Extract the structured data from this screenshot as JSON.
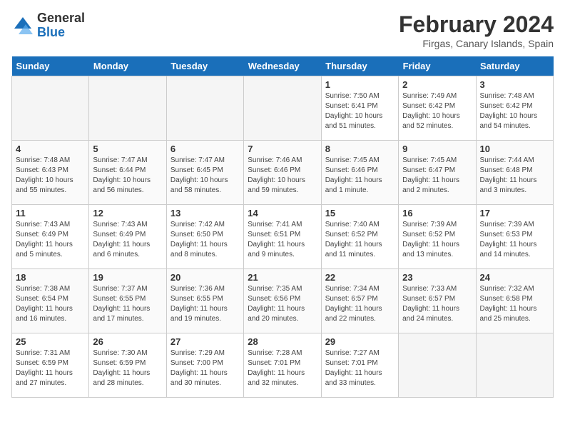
{
  "header": {
    "logo_general": "General",
    "logo_blue": "Blue",
    "month_year": "February 2024",
    "location": "Firgas, Canary Islands, Spain"
  },
  "weekdays": [
    "Sunday",
    "Monday",
    "Tuesday",
    "Wednesday",
    "Thursday",
    "Friday",
    "Saturday"
  ],
  "weeks": [
    [
      {
        "day": "",
        "empty": true
      },
      {
        "day": "",
        "empty": true
      },
      {
        "day": "",
        "empty": true
      },
      {
        "day": "",
        "empty": true
      },
      {
        "day": "1",
        "sunrise": "7:50 AM",
        "sunset": "6:41 PM",
        "daylight": "10 hours and 51 minutes."
      },
      {
        "day": "2",
        "sunrise": "7:49 AM",
        "sunset": "6:42 PM",
        "daylight": "10 hours and 52 minutes."
      },
      {
        "day": "3",
        "sunrise": "7:48 AM",
        "sunset": "6:42 PM",
        "daylight": "10 hours and 54 minutes."
      }
    ],
    [
      {
        "day": "4",
        "sunrise": "7:48 AM",
        "sunset": "6:43 PM",
        "daylight": "10 hours and 55 minutes."
      },
      {
        "day": "5",
        "sunrise": "7:47 AM",
        "sunset": "6:44 PM",
        "daylight": "10 hours and 56 minutes."
      },
      {
        "day": "6",
        "sunrise": "7:47 AM",
        "sunset": "6:45 PM",
        "daylight": "10 hours and 58 minutes."
      },
      {
        "day": "7",
        "sunrise": "7:46 AM",
        "sunset": "6:46 PM",
        "daylight": "10 hours and 59 minutes."
      },
      {
        "day": "8",
        "sunrise": "7:45 AM",
        "sunset": "6:46 PM",
        "daylight": "11 hours and 1 minute."
      },
      {
        "day": "9",
        "sunrise": "7:45 AM",
        "sunset": "6:47 PM",
        "daylight": "11 hours and 2 minutes."
      },
      {
        "day": "10",
        "sunrise": "7:44 AM",
        "sunset": "6:48 PM",
        "daylight": "11 hours and 3 minutes."
      }
    ],
    [
      {
        "day": "11",
        "sunrise": "7:43 AM",
        "sunset": "6:49 PM",
        "daylight": "11 hours and 5 minutes."
      },
      {
        "day": "12",
        "sunrise": "7:43 AM",
        "sunset": "6:49 PM",
        "daylight": "11 hours and 6 minutes."
      },
      {
        "day": "13",
        "sunrise": "7:42 AM",
        "sunset": "6:50 PM",
        "daylight": "11 hours and 8 minutes."
      },
      {
        "day": "14",
        "sunrise": "7:41 AM",
        "sunset": "6:51 PM",
        "daylight": "11 hours and 9 minutes."
      },
      {
        "day": "15",
        "sunrise": "7:40 AM",
        "sunset": "6:52 PM",
        "daylight": "11 hours and 11 minutes."
      },
      {
        "day": "16",
        "sunrise": "7:39 AM",
        "sunset": "6:52 PM",
        "daylight": "11 hours and 13 minutes."
      },
      {
        "day": "17",
        "sunrise": "7:39 AM",
        "sunset": "6:53 PM",
        "daylight": "11 hours and 14 minutes."
      }
    ],
    [
      {
        "day": "18",
        "sunrise": "7:38 AM",
        "sunset": "6:54 PM",
        "daylight": "11 hours and 16 minutes."
      },
      {
        "day": "19",
        "sunrise": "7:37 AM",
        "sunset": "6:55 PM",
        "daylight": "11 hours and 17 minutes."
      },
      {
        "day": "20",
        "sunrise": "7:36 AM",
        "sunset": "6:55 PM",
        "daylight": "11 hours and 19 minutes."
      },
      {
        "day": "21",
        "sunrise": "7:35 AM",
        "sunset": "6:56 PM",
        "daylight": "11 hours and 20 minutes."
      },
      {
        "day": "22",
        "sunrise": "7:34 AM",
        "sunset": "6:57 PM",
        "daylight": "11 hours and 22 minutes."
      },
      {
        "day": "23",
        "sunrise": "7:33 AM",
        "sunset": "6:57 PM",
        "daylight": "11 hours and 24 minutes."
      },
      {
        "day": "24",
        "sunrise": "7:32 AM",
        "sunset": "6:58 PM",
        "daylight": "11 hours and 25 minutes."
      }
    ],
    [
      {
        "day": "25",
        "sunrise": "7:31 AM",
        "sunset": "6:59 PM",
        "daylight": "11 hours and 27 minutes."
      },
      {
        "day": "26",
        "sunrise": "7:30 AM",
        "sunset": "6:59 PM",
        "daylight": "11 hours and 28 minutes."
      },
      {
        "day": "27",
        "sunrise": "7:29 AM",
        "sunset": "7:00 PM",
        "daylight": "11 hours and 30 minutes."
      },
      {
        "day": "28",
        "sunrise": "7:28 AM",
        "sunset": "7:01 PM",
        "daylight": "11 hours and 32 minutes."
      },
      {
        "day": "29",
        "sunrise": "7:27 AM",
        "sunset": "7:01 PM",
        "daylight": "11 hours and 33 minutes."
      },
      {
        "day": "",
        "empty": true
      },
      {
        "day": "",
        "empty": true
      }
    ]
  ]
}
